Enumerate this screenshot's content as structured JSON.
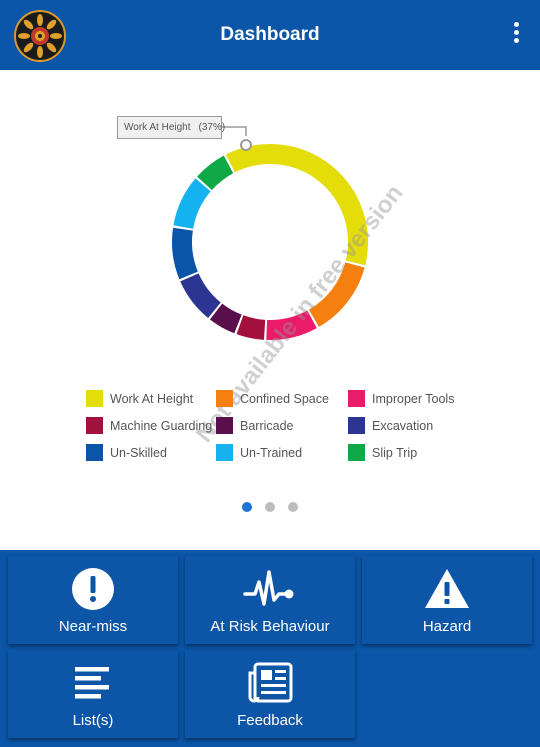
{
  "appbar": {
    "title": "Dashboard",
    "logo_icon": "mandala-logo-icon",
    "menu_icon": "more-vert-icon"
  },
  "tooltip": {
    "label": "Work At Height",
    "percent": "(37%)"
  },
  "watermark": "Not available in free version",
  "chart_data": {
    "type": "pie",
    "style": "donut",
    "unit": "percent",
    "slices": [
      {
        "name": "Work At Height",
        "value": 37,
        "color": "#e5dd0a"
      },
      {
        "name": "Confined Space",
        "value": 13,
        "color": "#f57f0f"
      },
      {
        "name": "Improper Tools",
        "value": 9,
        "color": "#ea1c69"
      },
      {
        "name": "Machine Guarding",
        "value": 5,
        "color": "#a3103e"
      },
      {
        "name": "Barricade",
        "value": 5,
        "color": "#5a0f4d"
      },
      {
        "name": "Excavation",
        "value": 8,
        "color": "#2d3593"
      },
      {
        "name": "Un-Skilled",
        "value": 9,
        "color": "#0a54a9"
      },
      {
        "name": "Un-Trained",
        "value": 9,
        "color": "#14b2ee"
      },
      {
        "name": "Slip Trip",
        "value": 6,
        "color": "#0ea847"
      }
    ],
    "legend_placement": "bottom",
    "legend": [
      {
        "name": "Work At Height",
        "color": "#e5dd0a"
      },
      {
        "name": "Confined Space",
        "color": "#f57f0f"
      },
      {
        "name": "Improper Tools",
        "color": "#ea1c69"
      },
      {
        "name": "Machine Guarding",
        "color": "#a3103e"
      },
      {
        "name": "Barricade",
        "color": "#5a0f4d"
      },
      {
        "name": "Excavation",
        "color": "#2d3593"
      },
      {
        "name": "Un-Skilled",
        "color": "#0a54a9"
      },
      {
        "name": "Un-Trained",
        "color": "#14b2ee"
      },
      {
        "name": "Slip Trip",
        "color": "#0ea847"
      }
    ]
  },
  "pager": {
    "pages": 3,
    "active": 1
  },
  "tiles": [
    {
      "label": "Near-miss",
      "icon": "exclamation-circle-icon"
    },
    {
      "label": "At Risk Behaviour",
      "icon": "heartbeat-icon"
    },
    {
      "label": "Hazard",
      "icon": "warning-triangle-icon"
    },
    {
      "label": "List(s)",
      "icon": "list-lines-icon"
    },
    {
      "label": "Feedback",
      "icon": "newspaper-icon"
    }
  ],
  "colors": {
    "primary": "#0b56a8",
    "tile": "#0d55a6",
    "pager_active": "#1e73d9"
  }
}
